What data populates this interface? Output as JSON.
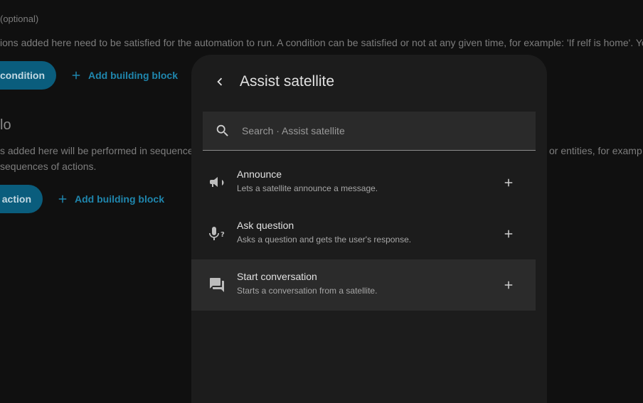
{
  "background": {
    "optional_label": "(optional)",
    "conditions_description": "ions added here need to be satisfied for the automation to run. A condition can be satisfied or not at any given time, for example: 'If relf is home'. Yo",
    "add_condition_label": "l condition",
    "add_building_block_label": "Add building block",
    "then_do_heading": "lo",
    "actions_description_left": "s added here will be performed in sequence",
    "actions_description_right": "or entities, for examp",
    "actions_description_line2": "sequences of actions.",
    "add_action_label": "l action",
    "add_building_block_label_2": "Add building block"
  },
  "dialog": {
    "title": "Assist satellite",
    "search_placeholder": "Search · Assist satellite",
    "items": [
      {
        "title": "Announce",
        "description": "Lets a satellite announce a message.",
        "icon": "bullhorn-icon"
      },
      {
        "title": "Ask question",
        "description": "Asks a question and gets the user's response.",
        "icon": "microphone-question-icon"
      },
      {
        "title": "Start conversation",
        "description": "Starts a conversation from a satellite.",
        "icon": "forum-icon"
      }
    ]
  },
  "colors": {
    "accent": "#1f86ad",
    "pill": "#0a5d7d",
    "dialog_bg": "#1c1c1c",
    "page_bg": "#101010"
  }
}
